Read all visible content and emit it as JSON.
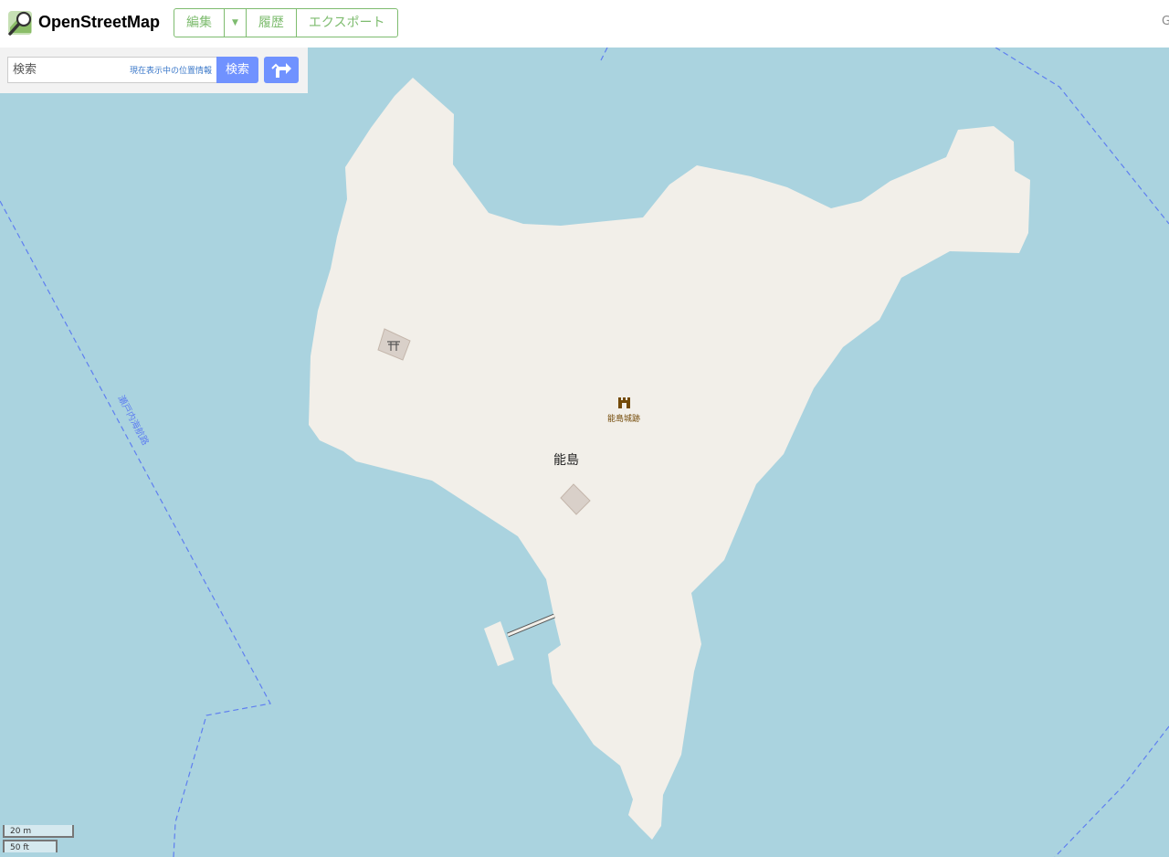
{
  "header": {
    "brand": "OpenStreetMap",
    "buttons": {
      "edit": "編集",
      "history": "履歴",
      "export": "エクスポート"
    },
    "edge_glyph": "G"
  },
  "search": {
    "placeholder": "検索",
    "where_am_i": "現在表示中の位置情報",
    "search_button": "検索"
  },
  "map": {
    "island_label": "能島",
    "castle_label": "能島城跡",
    "boundary_label": "瀬戸内海航路",
    "colors": {
      "water": "#aad3df",
      "land": "#f2efe9",
      "building": "#d9d0c9",
      "boundary": "#5f7ff0",
      "castle_icon": "#734a08"
    }
  },
  "scale": {
    "metric": "20 m",
    "imperial": "50 ft"
  }
}
